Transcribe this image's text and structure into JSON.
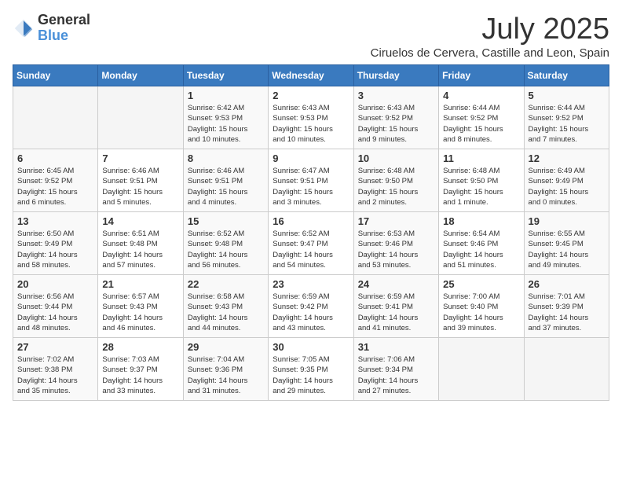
{
  "header": {
    "logo_general": "General",
    "logo_blue": "Blue",
    "month_title": "July 2025",
    "location": "Ciruelos de Cervera, Castille and Leon, Spain"
  },
  "days_of_week": [
    "Sunday",
    "Monday",
    "Tuesday",
    "Wednesday",
    "Thursday",
    "Friday",
    "Saturday"
  ],
  "weeks": [
    [
      {
        "day": "",
        "info": ""
      },
      {
        "day": "",
        "info": ""
      },
      {
        "day": "1",
        "info": "Sunrise: 6:42 AM\nSunset: 9:53 PM\nDaylight: 15 hours\nand 10 minutes."
      },
      {
        "day": "2",
        "info": "Sunrise: 6:43 AM\nSunset: 9:53 PM\nDaylight: 15 hours\nand 10 minutes."
      },
      {
        "day": "3",
        "info": "Sunrise: 6:43 AM\nSunset: 9:52 PM\nDaylight: 15 hours\nand 9 minutes."
      },
      {
        "day": "4",
        "info": "Sunrise: 6:44 AM\nSunset: 9:52 PM\nDaylight: 15 hours\nand 8 minutes."
      },
      {
        "day": "5",
        "info": "Sunrise: 6:44 AM\nSunset: 9:52 PM\nDaylight: 15 hours\nand 7 minutes."
      }
    ],
    [
      {
        "day": "6",
        "info": "Sunrise: 6:45 AM\nSunset: 9:52 PM\nDaylight: 15 hours\nand 6 minutes."
      },
      {
        "day": "7",
        "info": "Sunrise: 6:46 AM\nSunset: 9:51 PM\nDaylight: 15 hours\nand 5 minutes."
      },
      {
        "day": "8",
        "info": "Sunrise: 6:46 AM\nSunset: 9:51 PM\nDaylight: 15 hours\nand 4 minutes."
      },
      {
        "day": "9",
        "info": "Sunrise: 6:47 AM\nSunset: 9:51 PM\nDaylight: 15 hours\nand 3 minutes."
      },
      {
        "day": "10",
        "info": "Sunrise: 6:48 AM\nSunset: 9:50 PM\nDaylight: 15 hours\nand 2 minutes."
      },
      {
        "day": "11",
        "info": "Sunrise: 6:48 AM\nSunset: 9:50 PM\nDaylight: 15 hours\nand 1 minute."
      },
      {
        "day": "12",
        "info": "Sunrise: 6:49 AM\nSunset: 9:49 PM\nDaylight: 15 hours\nand 0 minutes."
      }
    ],
    [
      {
        "day": "13",
        "info": "Sunrise: 6:50 AM\nSunset: 9:49 PM\nDaylight: 14 hours\nand 58 minutes."
      },
      {
        "day": "14",
        "info": "Sunrise: 6:51 AM\nSunset: 9:48 PM\nDaylight: 14 hours\nand 57 minutes."
      },
      {
        "day": "15",
        "info": "Sunrise: 6:52 AM\nSunset: 9:48 PM\nDaylight: 14 hours\nand 56 minutes."
      },
      {
        "day": "16",
        "info": "Sunrise: 6:52 AM\nSunset: 9:47 PM\nDaylight: 14 hours\nand 54 minutes."
      },
      {
        "day": "17",
        "info": "Sunrise: 6:53 AM\nSunset: 9:46 PM\nDaylight: 14 hours\nand 53 minutes."
      },
      {
        "day": "18",
        "info": "Sunrise: 6:54 AM\nSunset: 9:46 PM\nDaylight: 14 hours\nand 51 minutes."
      },
      {
        "day": "19",
        "info": "Sunrise: 6:55 AM\nSunset: 9:45 PM\nDaylight: 14 hours\nand 49 minutes."
      }
    ],
    [
      {
        "day": "20",
        "info": "Sunrise: 6:56 AM\nSunset: 9:44 PM\nDaylight: 14 hours\nand 48 minutes."
      },
      {
        "day": "21",
        "info": "Sunrise: 6:57 AM\nSunset: 9:43 PM\nDaylight: 14 hours\nand 46 minutes."
      },
      {
        "day": "22",
        "info": "Sunrise: 6:58 AM\nSunset: 9:43 PM\nDaylight: 14 hours\nand 44 minutes."
      },
      {
        "day": "23",
        "info": "Sunrise: 6:59 AM\nSunset: 9:42 PM\nDaylight: 14 hours\nand 43 minutes."
      },
      {
        "day": "24",
        "info": "Sunrise: 6:59 AM\nSunset: 9:41 PM\nDaylight: 14 hours\nand 41 minutes."
      },
      {
        "day": "25",
        "info": "Sunrise: 7:00 AM\nSunset: 9:40 PM\nDaylight: 14 hours\nand 39 minutes."
      },
      {
        "day": "26",
        "info": "Sunrise: 7:01 AM\nSunset: 9:39 PM\nDaylight: 14 hours\nand 37 minutes."
      }
    ],
    [
      {
        "day": "27",
        "info": "Sunrise: 7:02 AM\nSunset: 9:38 PM\nDaylight: 14 hours\nand 35 minutes."
      },
      {
        "day": "28",
        "info": "Sunrise: 7:03 AM\nSunset: 9:37 PM\nDaylight: 14 hours\nand 33 minutes."
      },
      {
        "day": "29",
        "info": "Sunrise: 7:04 AM\nSunset: 9:36 PM\nDaylight: 14 hours\nand 31 minutes."
      },
      {
        "day": "30",
        "info": "Sunrise: 7:05 AM\nSunset: 9:35 PM\nDaylight: 14 hours\nand 29 minutes."
      },
      {
        "day": "31",
        "info": "Sunrise: 7:06 AM\nSunset: 9:34 PM\nDaylight: 14 hours\nand 27 minutes."
      },
      {
        "day": "",
        "info": ""
      },
      {
        "day": "",
        "info": ""
      }
    ]
  ]
}
